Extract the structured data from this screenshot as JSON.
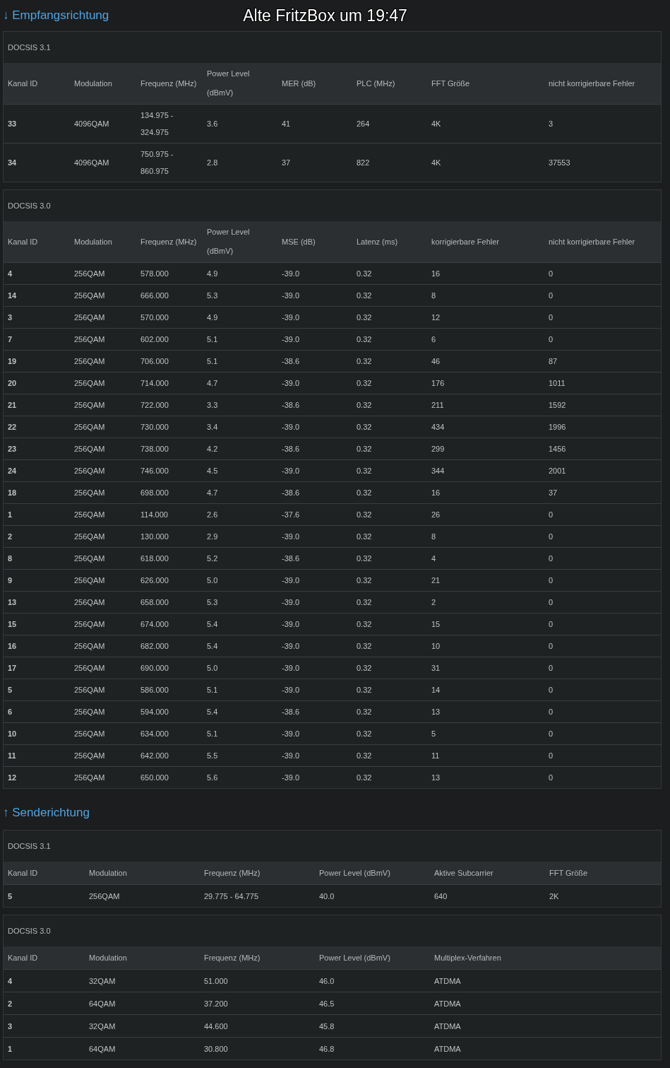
{
  "caption": "Alte FritzBox um 19:47",
  "sections": [
    {
      "arrow": "↓",
      "title": "Empfangsrichtung",
      "tables": [
        {
          "title": "DOCSIS 3.1",
          "columns": [
            "Kanal ID",
            "Modulation",
            "Frequenz (MHz)",
            "Power Level (dBmV)",
            "MER (dB)",
            "PLC (MHz)",
            "FFT Größe",
            "nicht korrigierbare Fehler"
          ],
          "rows": [
            [
              "33",
              "4096QAM",
              "134.975 - 324.975",
              "3.6",
              "41",
              "264",
              "4K",
              "3"
            ],
            [
              "34",
              "4096QAM",
              "750.975 - 860.975",
              "2.8",
              "37",
              "822",
              "4K",
              "37553"
            ]
          ]
        },
        {
          "title": "DOCSIS 3.0",
          "columns": [
            "Kanal ID",
            "Modulation",
            "Frequenz (MHz)",
            "Power Level (dBmV)",
            "MSE (dB)",
            "Latenz (ms)",
            "korrigierbare Fehler",
            "nicht korrigierbare Fehler"
          ],
          "rows": [
            [
              "4",
              "256QAM",
              "578.000",
              "4.9",
              "-39.0",
              "0.32",
              "16",
              "0"
            ],
            [
              "14",
              "256QAM",
              "666.000",
              "5.3",
              "-39.0",
              "0.32",
              "8",
              "0"
            ],
            [
              "3",
              "256QAM",
              "570.000",
              "4.9",
              "-39.0",
              "0.32",
              "12",
              "0"
            ],
            [
              "7",
              "256QAM",
              "602.000",
              "5.1",
              "-39.0",
              "0.32",
              "6",
              "0"
            ],
            [
              "19",
              "256QAM",
              "706.000",
              "5.1",
              "-38.6",
              "0.32",
              "46",
              "87"
            ],
            [
              "20",
              "256QAM",
              "714.000",
              "4.7",
              "-39.0",
              "0.32",
              "176",
              "1011"
            ],
            [
              "21",
              "256QAM",
              "722.000",
              "3.3",
              "-38.6",
              "0.32",
              "211",
              "1592"
            ],
            [
              "22",
              "256QAM",
              "730.000",
              "3.4",
              "-39.0",
              "0.32",
              "434",
              "1996"
            ],
            [
              "23",
              "256QAM",
              "738.000",
              "4.2",
              "-38.6",
              "0.32",
              "299",
              "1456"
            ],
            [
              "24",
              "256QAM",
              "746.000",
              "4.5",
              "-39.0",
              "0.32",
              "344",
              "2001"
            ],
            [
              "18",
              "256QAM",
              "698.000",
              "4.7",
              "-38.6",
              "0.32",
              "16",
              "37"
            ],
            [
              "1",
              "256QAM",
              "114.000",
              "2.6",
              "-37.6",
              "0.32",
              "26",
              "0"
            ],
            [
              "2",
              "256QAM",
              "130.000",
              "2.9",
              "-39.0",
              "0.32",
              "8",
              "0"
            ],
            [
              "8",
              "256QAM",
              "618.000",
              "5.2",
              "-38.6",
              "0.32",
              "4",
              "0"
            ],
            [
              "9",
              "256QAM",
              "626.000",
              "5.0",
              "-39.0",
              "0.32",
              "21",
              "0"
            ],
            [
              "13",
              "256QAM",
              "658.000",
              "5.3",
              "-39.0",
              "0.32",
              "2",
              "0"
            ],
            [
              "15",
              "256QAM",
              "674.000",
              "5.4",
              "-39.0",
              "0.32",
              "15",
              "0"
            ],
            [
              "16",
              "256QAM",
              "682.000",
              "5.4",
              "-39.0",
              "0.32",
              "10",
              "0"
            ],
            [
              "17",
              "256QAM",
              "690.000",
              "5.0",
              "-39.0",
              "0.32",
              "31",
              "0"
            ],
            [
              "5",
              "256QAM",
              "586.000",
              "5.1",
              "-39.0",
              "0.32",
              "14",
              "0"
            ],
            [
              "6",
              "256QAM",
              "594.000",
              "5.4",
              "-38.6",
              "0.32",
              "13",
              "0"
            ],
            [
              "10",
              "256QAM",
              "634.000",
              "5.1",
              "-39.0",
              "0.32",
              "5",
              "0"
            ],
            [
              "11",
              "256QAM",
              "642.000",
              "5.5",
              "-39.0",
              "0.32",
              "11",
              "0"
            ],
            [
              "12",
              "256QAM",
              "650.000",
              "5.6",
              "-39.0",
              "0.32",
              "13",
              "0"
            ]
          ]
        }
      ]
    },
    {
      "arrow": "↑",
      "title": "Senderichtung",
      "tables": [
        {
          "title": "DOCSIS 3.1",
          "columns": [
            "Kanal ID",
            "Modulation",
            "Frequenz (MHz)",
            "Power Level (dBmV)",
            "Aktive Subcarrier",
            "FFT Größe"
          ],
          "rows": [
            [
              "5",
              "256QAM",
              "29.775 - 64.775",
              "40.0",
              "640",
              "2K"
            ]
          ]
        },
        {
          "title": "DOCSIS 3.0",
          "columns": [
            "Kanal ID",
            "Modulation",
            "Frequenz (MHz)",
            "Power Level (dBmV)",
            "Multiplex-Verfahren"
          ],
          "rows": [
            [
              "4",
              "32QAM",
              "51.000",
              "46.0",
              "ATDMA"
            ],
            [
              "2",
              "64QAM",
              "37.200",
              "46.5",
              "ATDMA"
            ],
            [
              "3",
              "32QAM",
              "44.600",
              "45.8",
              "ATDMA"
            ],
            [
              "1",
              "64QAM",
              "30.800",
              "46.8",
              "ATDMA"
            ]
          ]
        }
      ]
    }
  ]
}
